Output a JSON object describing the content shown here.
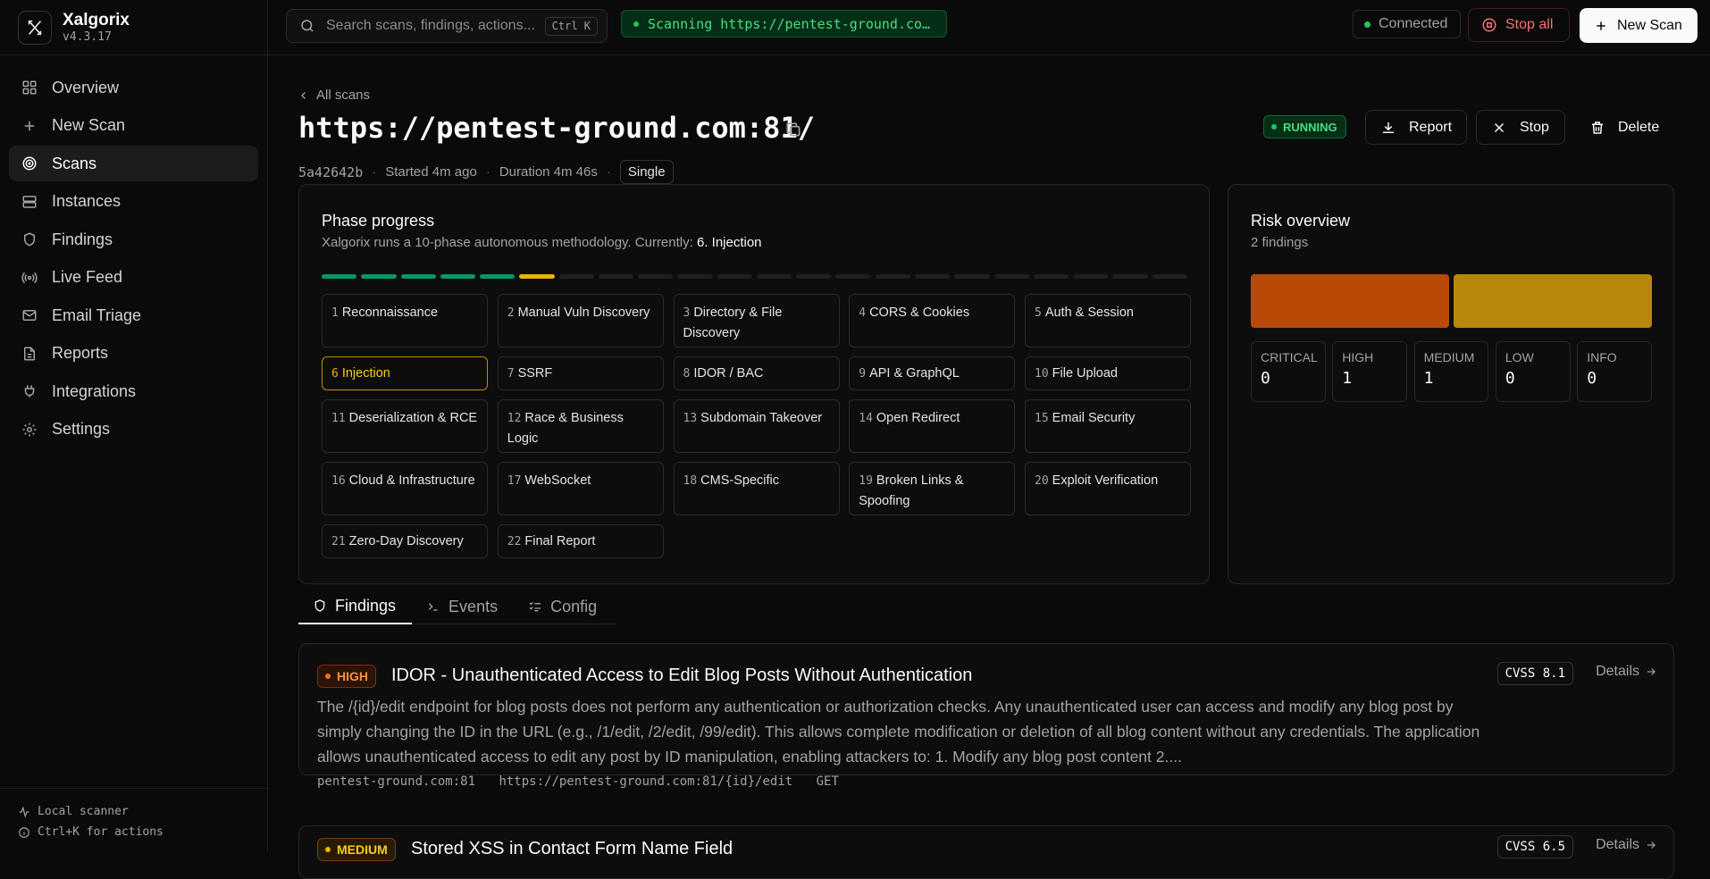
{
  "app": {
    "name": "Xalgorix",
    "version": "v4.3.17"
  },
  "sidebar": {
    "items": [
      {
        "label": "Overview",
        "icon": "grid-icon"
      },
      {
        "label": "New Scan",
        "icon": "plus-icon"
      },
      {
        "label": "Scans",
        "icon": "target-icon",
        "active": true
      },
      {
        "label": "Instances",
        "icon": "server-icon"
      },
      {
        "label": "Findings",
        "icon": "shield-icon"
      },
      {
        "label": "Live Feed",
        "icon": "radio-icon"
      },
      {
        "label": "Email Triage",
        "icon": "mail-icon"
      },
      {
        "label": "Reports",
        "icon": "file-icon"
      },
      {
        "label": "Integrations",
        "icon": "plug-icon"
      },
      {
        "label": "Settings",
        "icon": "gear-icon"
      }
    ],
    "footer": {
      "line1": "Local scanner",
      "line2": "Ctrl+K for actions"
    }
  },
  "topbar": {
    "search_placeholder": "Search scans, findings, actions...",
    "search_shortcut": "Ctrl K",
    "scanning_text": "Scanning https://pentest-ground.co…",
    "connection": "Connected",
    "stop_all": "Stop all",
    "new_scan": "New Scan"
  },
  "scan": {
    "back_label": "All scans",
    "title": "https://pentest-ground.com:81/",
    "id": "5a42642b",
    "started": "Started 4m ago",
    "duration": "Duration 4m 46s",
    "mode": "Single",
    "status": "RUNNING",
    "actions": {
      "report": "Report",
      "stop": "Stop",
      "delete": "Delete"
    }
  },
  "phase_progress": {
    "title": "Phase progress",
    "subtitle_prefix": "Xalgorix runs a 10-phase autonomous methodology. Currently:",
    "current": "6. Injection",
    "segments_total": 22,
    "segments_done": 5,
    "segments_current": 6,
    "phases": [
      {
        "n": "1",
        "name": "Reconnaissance"
      },
      {
        "n": "2",
        "name": "Manual Vuln Discovery"
      },
      {
        "n": "3",
        "name": "Directory & File Discovery"
      },
      {
        "n": "4",
        "name": "CORS & Cookies"
      },
      {
        "n": "5",
        "name": "Auth & Session"
      },
      {
        "n": "6",
        "name": "Injection",
        "active": true
      },
      {
        "n": "7",
        "name": "SSRF"
      },
      {
        "n": "8",
        "name": "IDOR / BAC"
      },
      {
        "n": "9",
        "name": "API & GraphQL"
      },
      {
        "n": "10",
        "name": "File Upload"
      },
      {
        "n": "11",
        "name": "Deserialization & RCE"
      },
      {
        "n": "12",
        "name": "Race & Business Logic"
      },
      {
        "n": "13",
        "name": "Subdomain Takeover"
      },
      {
        "n": "14",
        "name": "Open Redirect"
      },
      {
        "n": "15",
        "name": "Email Security"
      },
      {
        "n": "16",
        "name": "Cloud & Infrastructure"
      },
      {
        "n": "17",
        "name": "WebSocket"
      },
      {
        "n": "18",
        "name": "CMS-Specific"
      },
      {
        "n": "19",
        "name": "Broken Links & Spoofing"
      },
      {
        "n": "20",
        "name": "Exploit Verification"
      },
      {
        "n": "21",
        "name": "Zero-Day Discovery"
      },
      {
        "n": "22",
        "name": "Final Report"
      }
    ]
  },
  "risk": {
    "title": "Risk overview",
    "subtitle": "2 findings",
    "bar_colors": [
      "#b94a06",
      "#b8860b"
    ],
    "severities": [
      {
        "label": "CRITICAL",
        "value": "0"
      },
      {
        "label": "HIGH",
        "value": "1"
      },
      {
        "label": "MEDIUM",
        "value": "1"
      },
      {
        "label": "LOW",
        "value": "0"
      },
      {
        "label": "INFO",
        "value": "0"
      }
    ]
  },
  "tabs": [
    {
      "label": "Findings",
      "icon": "shield-icon",
      "active": true
    },
    {
      "label": "Events",
      "icon": "terminal-icon"
    },
    {
      "label": "Config",
      "icon": "list-check-icon"
    }
  ],
  "findings": [
    {
      "severity": "HIGH",
      "title": "IDOR - Unauthenticated Access to Edit Blog Posts Without Authentication",
      "cvss": "CVSS 8.1",
      "details": "Details",
      "description": "The /{id}/edit endpoint for blog posts does not perform any authentication or authorization checks. Any unauthenticated user can access and modify any blog post by simply changing the ID in the URL (e.g., /1/edit, /2/edit, /99/edit). This allows complete modification or deletion of all blog content without any credentials. The application allows unauthenticated access to edit any post by ID manipulation, enabling attackers to: 1. Modify any blog post content 2....",
      "host": "pentest-ground.com:81",
      "url": "https://pentest-ground.com:81/{id}/edit",
      "method": "GET"
    },
    {
      "severity": "MEDIUM",
      "title": "Stored XSS in Contact Form Name Field",
      "cvss": "CVSS 6.5",
      "details": "Details"
    }
  ]
}
